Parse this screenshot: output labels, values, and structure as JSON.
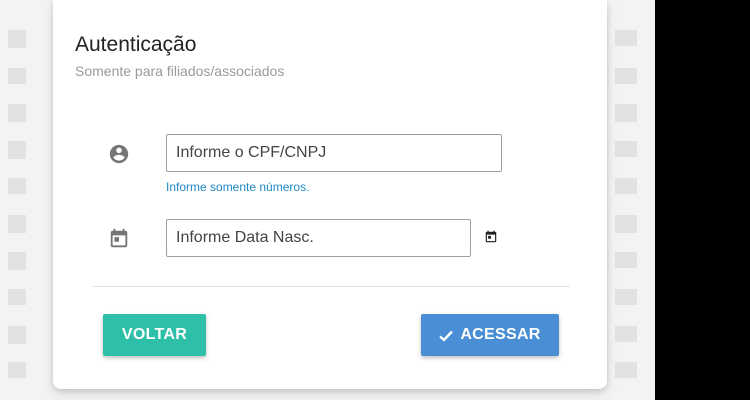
{
  "auth": {
    "title": "Autenticação",
    "subtitle": "Somente para filiados/associados"
  },
  "form": {
    "cpf": {
      "placeholder": "Informe o CPF/CNPJ",
      "value": "",
      "hint": "Informe somente números.",
      "icon": "account-circle-icon"
    },
    "birthdate": {
      "placeholder": "Informe Data Nasc.",
      "value": "",
      "icon": "calendar-icon",
      "picker_icon": "calendar-picker-icon"
    }
  },
  "actions": {
    "back_label": "VOLTAR",
    "access_label": "ACESSAR",
    "access_icon": "check-icon"
  },
  "colors": {
    "back_button": "#2ebfa8",
    "access_button": "#4a8fd6",
    "hint_text": "#1e88c7"
  }
}
